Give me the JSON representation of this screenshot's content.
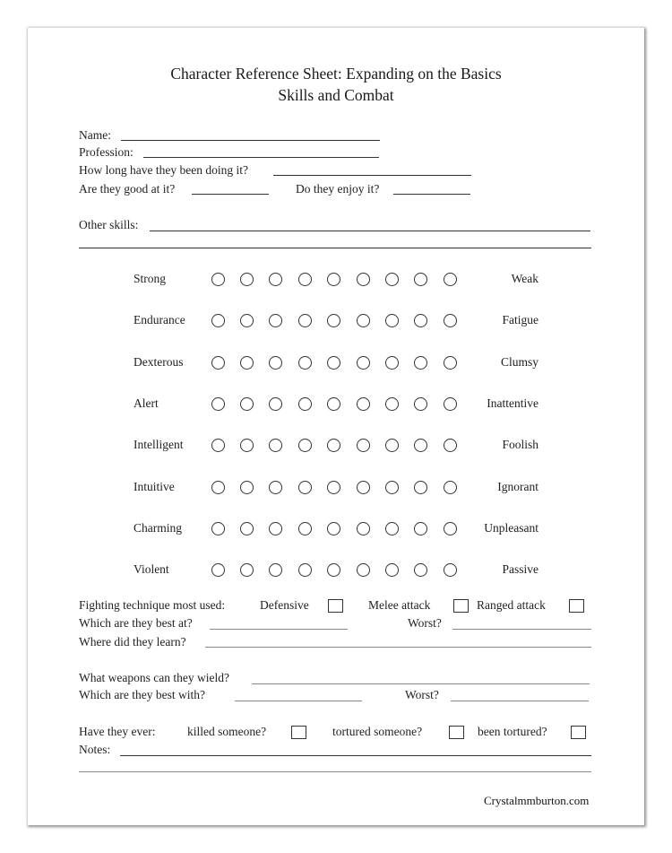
{
  "document": {
    "title_line1": "Character Reference Sheet: Expanding on the Basics",
    "title_line2": "Skills and Combat",
    "footer": "Crystalmmburton.com"
  },
  "basics": {
    "name_label": "Name:",
    "profession_label": "Profession:",
    "how_long_label": "How long have they been doing it?",
    "good_at_label": "Are they good at it?",
    "enjoy_label": "Do they enjoy it?",
    "other_skills_label": "Other skills:"
  },
  "scales": {
    "points": 9,
    "rows": [
      {
        "left": "Strong",
        "right": "Weak",
        "selected": null
      },
      {
        "left": "Endurance",
        "right": "Fatigue",
        "selected": null
      },
      {
        "left": "Dexterous",
        "right": "Clumsy",
        "selected": null
      },
      {
        "left": "Alert",
        "right": "Inattentive",
        "selected": null
      },
      {
        "left": "Intelligent",
        "right": "Foolish",
        "selected": null
      },
      {
        "left": "Intuitive",
        "right": "Ignorant",
        "selected": null
      },
      {
        "left": "Charming",
        "right": "Unpleasant",
        "selected": null
      },
      {
        "left": "Violent",
        "right": "Passive",
        "selected": null
      }
    ]
  },
  "fighting": {
    "technique_label": "Fighting technique most used:",
    "options": [
      {
        "label": "Defensive",
        "checked": false
      },
      {
        "label": "Melee attack",
        "checked": false
      },
      {
        "label": "Ranged attack",
        "checked": false
      }
    ],
    "best_at_label": "Which are they best at?",
    "worst_label": "Worst?",
    "learn_label": "Where did they learn?"
  },
  "weapons": {
    "wield_label": "What weapons can they wield?",
    "best_with_label": "Which are they best with?",
    "worst_label": "Worst?"
  },
  "history": {
    "ever_label": "Have they ever:",
    "options": [
      {
        "label": "killed someone?",
        "checked": false
      },
      {
        "label": "tortured someone?",
        "checked": false
      },
      {
        "label": "been tortured?",
        "checked": false
      }
    ],
    "notes_label": "Notes:"
  }
}
